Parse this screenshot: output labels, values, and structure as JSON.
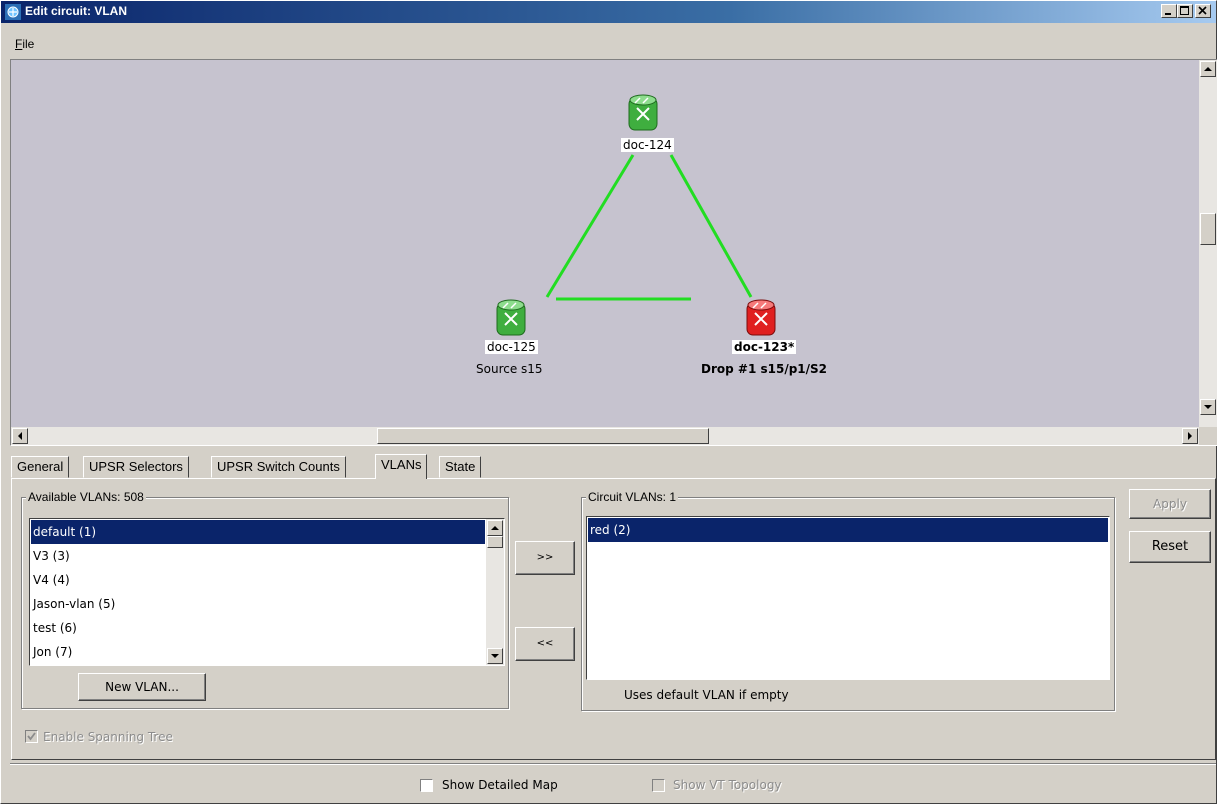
{
  "window": {
    "title": "Edit circuit: VLAN"
  },
  "menu": {
    "file_label": "File"
  },
  "map": {
    "nodes": [
      {
        "name": "doc-124",
        "sub": ""
      },
      {
        "name": "doc-125",
        "sub": "Source s15"
      },
      {
        "name": "doc-123*",
        "sub": "Drop #1 s15/p1/S2"
      }
    ],
    "colors": {
      "link": "#22dd22",
      "normal_node": "#3fae3f",
      "drop_node": "#e02020",
      "canvas": "#c6c3cf"
    }
  },
  "tabs": [
    {
      "label": "General"
    },
    {
      "label": "UPSR Selectors"
    },
    {
      "label": "UPSR Switch Counts"
    },
    {
      "label": "VLANs"
    },
    {
      "label": "State"
    }
  ],
  "available": {
    "title": "Available VLANs: 508",
    "items": [
      "default (1)",
      "V3 (3)",
      "V4 (4)",
      "Jason-vlan (5)",
      "test (6)",
      "Jon (7)"
    ],
    "new_vlan_label": "New VLAN..."
  },
  "transfer": {
    "add_label": ">>",
    "remove_label": "<<"
  },
  "circuit": {
    "title": "Circuit VLANs: 1",
    "items": [
      "red (2)"
    ],
    "hint": "Uses default VLAN if empty"
  },
  "actions": {
    "apply_label": "Apply",
    "reset_label": "Reset"
  },
  "options": {
    "spanning_tree_label": "Enable Spanning Tree",
    "detailed_map_label": "Show Detailed Map",
    "vt_topology_label": "Show VT Topology"
  }
}
